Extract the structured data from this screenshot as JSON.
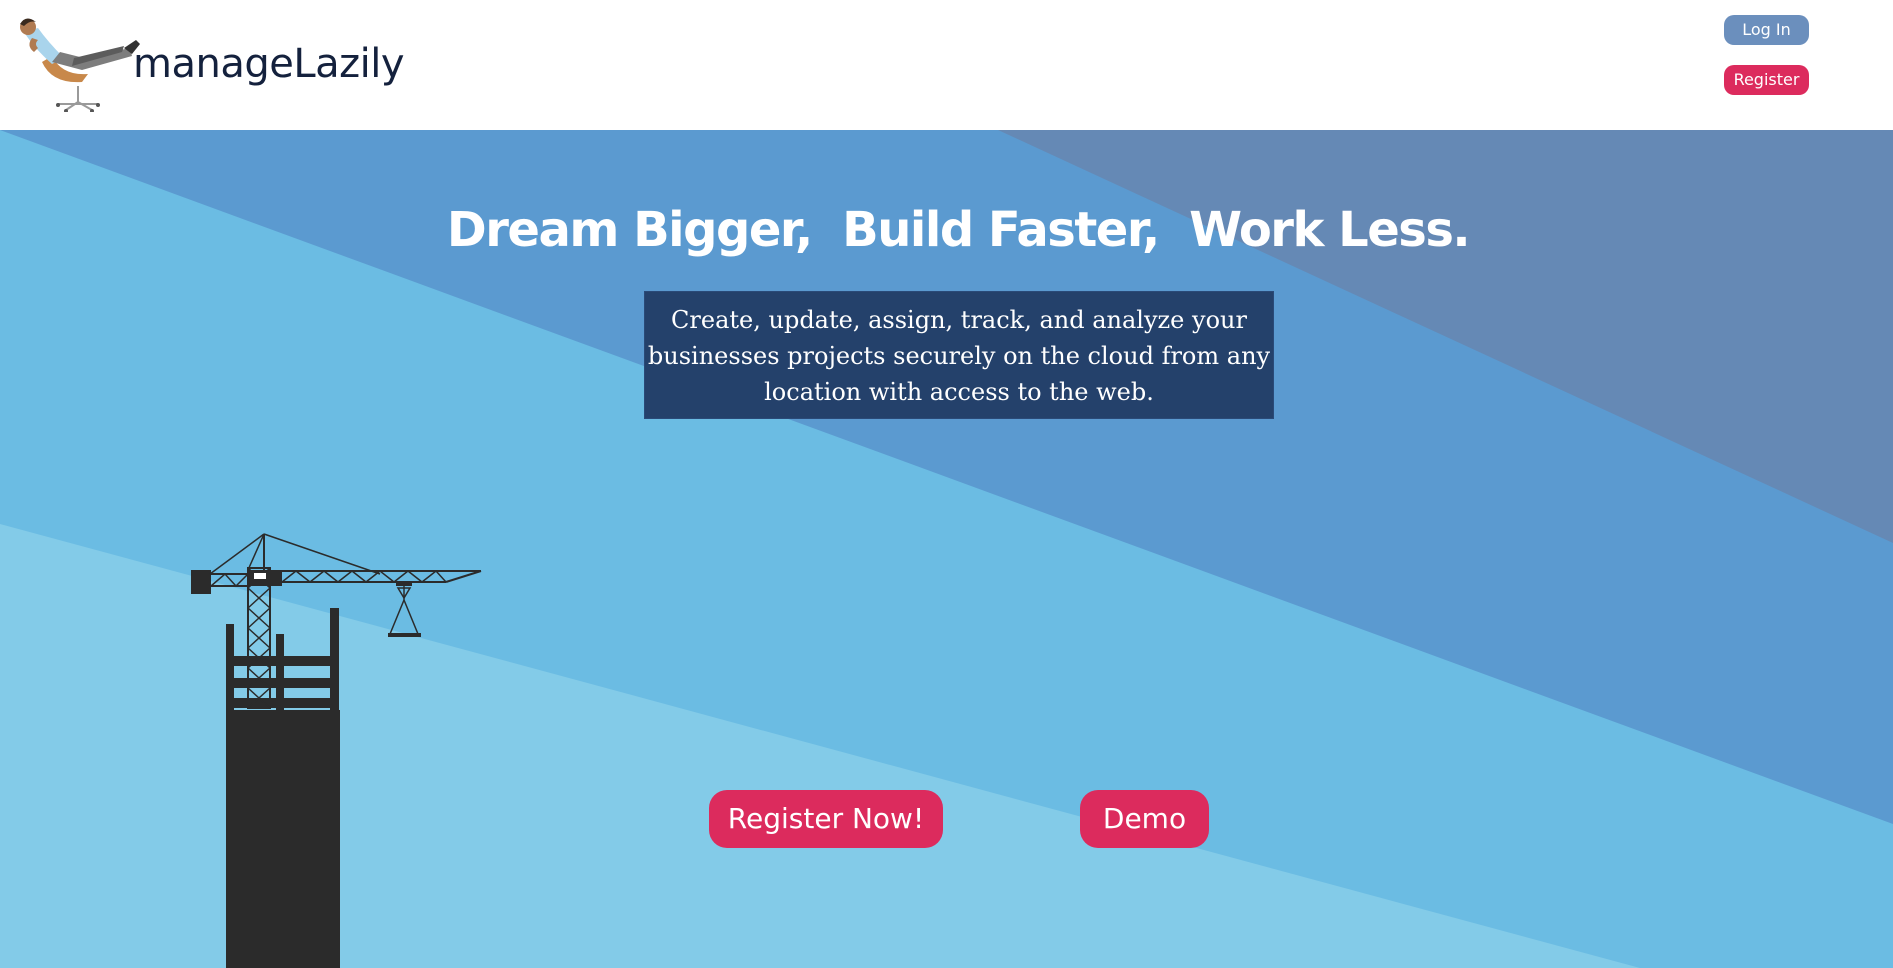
{
  "brand": {
    "name": "manageLazily",
    "logo_icon": "reclining-person-icon"
  },
  "nav": {
    "login_label": "Log In",
    "register_label": "Register"
  },
  "hero": {
    "headline": "Dream Bigger,  Build Faster,  Work Less.",
    "tagline": "Create, update, assign, track, and analyze your businesses projects securely on the cloud from any location with access to the web.",
    "register_now_label": "Register Now!",
    "demo_label": "Demo",
    "illustration_icon": "construction-crane-icon"
  },
  "colors": {
    "accent": "#dc2b5d",
    "login_button": "#6b8fbd",
    "tagline_bg": "#24416b",
    "sky_light": "#83cbe8",
    "sky_mid": "#6bbce3",
    "sky_blue": "#5b9ad0",
    "sky_slate": "#6589b5",
    "silhouette": "#2b2b2b"
  }
}
